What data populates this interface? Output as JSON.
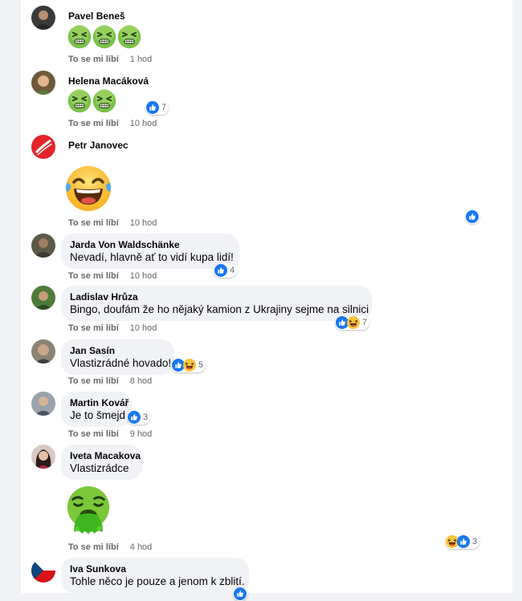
{
  "labels": {
    "like": "To se mi líbí"
  },
  "colors": {
    "like_blue": "#1877f2",
    "bubble_bg": "#f0f2f5",
    "emoji_yellow": "#ffcc33",
    "sick_green": "#3fb620"
  },
  "comments": [
    {
      "author": "Pavel Beneš",
      "text": "",
      "emojis": [
        "nauseated-face",
        "nauseated-face",
        "nauseated-face"
      ],
      "time": "1 hod",
      "reactions": [],
      "reaction_count": ""
    },
    {
      "author": "Helena Macáková",
      "text": "",
      "emojis": [
        "nauseated-face",
        "nauseated-face"
      ],
      "time": "10 hod",
      "reactions": [
        "like"
      ],
      "reaction_count": "7"
    },
    {
      "author": "Petr Janovec",
      "text": "",
      "emojis": [
        "tears-of-joy-face"
      ],
      "time": "10 hod",
      "reactions": [
        "like"
      ],
      "reaction_count": ""
    },
    {
      "author": "Jarda Von Waldschänke",
      "text": "Nevadí, hlavně ať to vidí kupa lidí!",
      "time": "10 hod",
      "reactions": [
        "like"
      ],
      "reaction_count": "4"
    },
    {
      "author": "Ladislav Hrůza",
      "text": "Bingo, doufám že ho nějaký kamion z Ukrajiny sejme na silnici",
      "time": "10 hod",
      "reactions": [
        "like",
        "haha"
      ],
      "reaction_count": "7"
    },
    {
      "author": "Jan Sasín",
      "text": "Vlastizrádné hovado!",
      "time": "8 hod",
      "reactions": [
        "like",
        "haha"
      ],
      "reaction_count": "5"
    },
    {
      "author": "Martin Kovář",
      "text": "Je to šmejd",
      "time": "9 hod",
      "reactions": [
        "like"
      ],
      "reaction_count": "3"
    },
    {
      "author": "Iveta Macakova",
      "text": "Vlastizrádce",
      "emojis": [
        "vomiting-face"
      ],
      "time": "4 hod",
      "reactions": [
        "haha",
        "like"
      ],
      "reaction_count": "3"
    },
    {
      "author": "Iva Sunkova",
      "text": "Tohle něco je pouze a jenom k zblití.",
      "time": "",
      "reactions": [
        "like"
      ],
      "reaction_count": ""
    }
  ]
}
